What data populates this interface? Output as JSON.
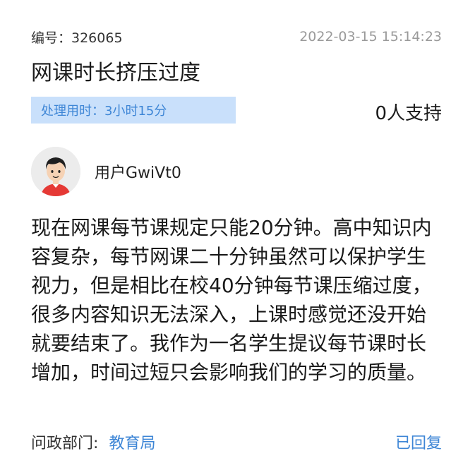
{
  "header": {
    "number_label": "编号：326065",
    "datetime": "2022-03-15 15:14:23"
  },
  "title": "网课时长挤压过度",
  "processing": {
    "label": "处理用时：3小时15分"
  },
  "support_count": "0人支持",
  "user": {
    "name": "用户GwiVt0",
    "avatar_icon": "user-avatar-icon"
  },
  "content": "现在网课每节课规定只能20分钟。高中知识内容复杂，每节网课二十分钟虽然可以保护学生视力，但是相比在校40分钟每节课压缩过度，很多内容知识无法深入，上课时感觉还没开始就要结束了。我作为一名学生提议每节课时长增加，时间过短只会影响我们的学习的质量。",
  "footer": {
    "dept_label": "问政部门:",
    "dept_value": "教育局",
    "status": "已回复"
  },
  "colors": {
    "accent": "#3e86d6",
    "badge_bg": "#c9e0fb",
    "muted": "#9a9a9a"
  }
}
